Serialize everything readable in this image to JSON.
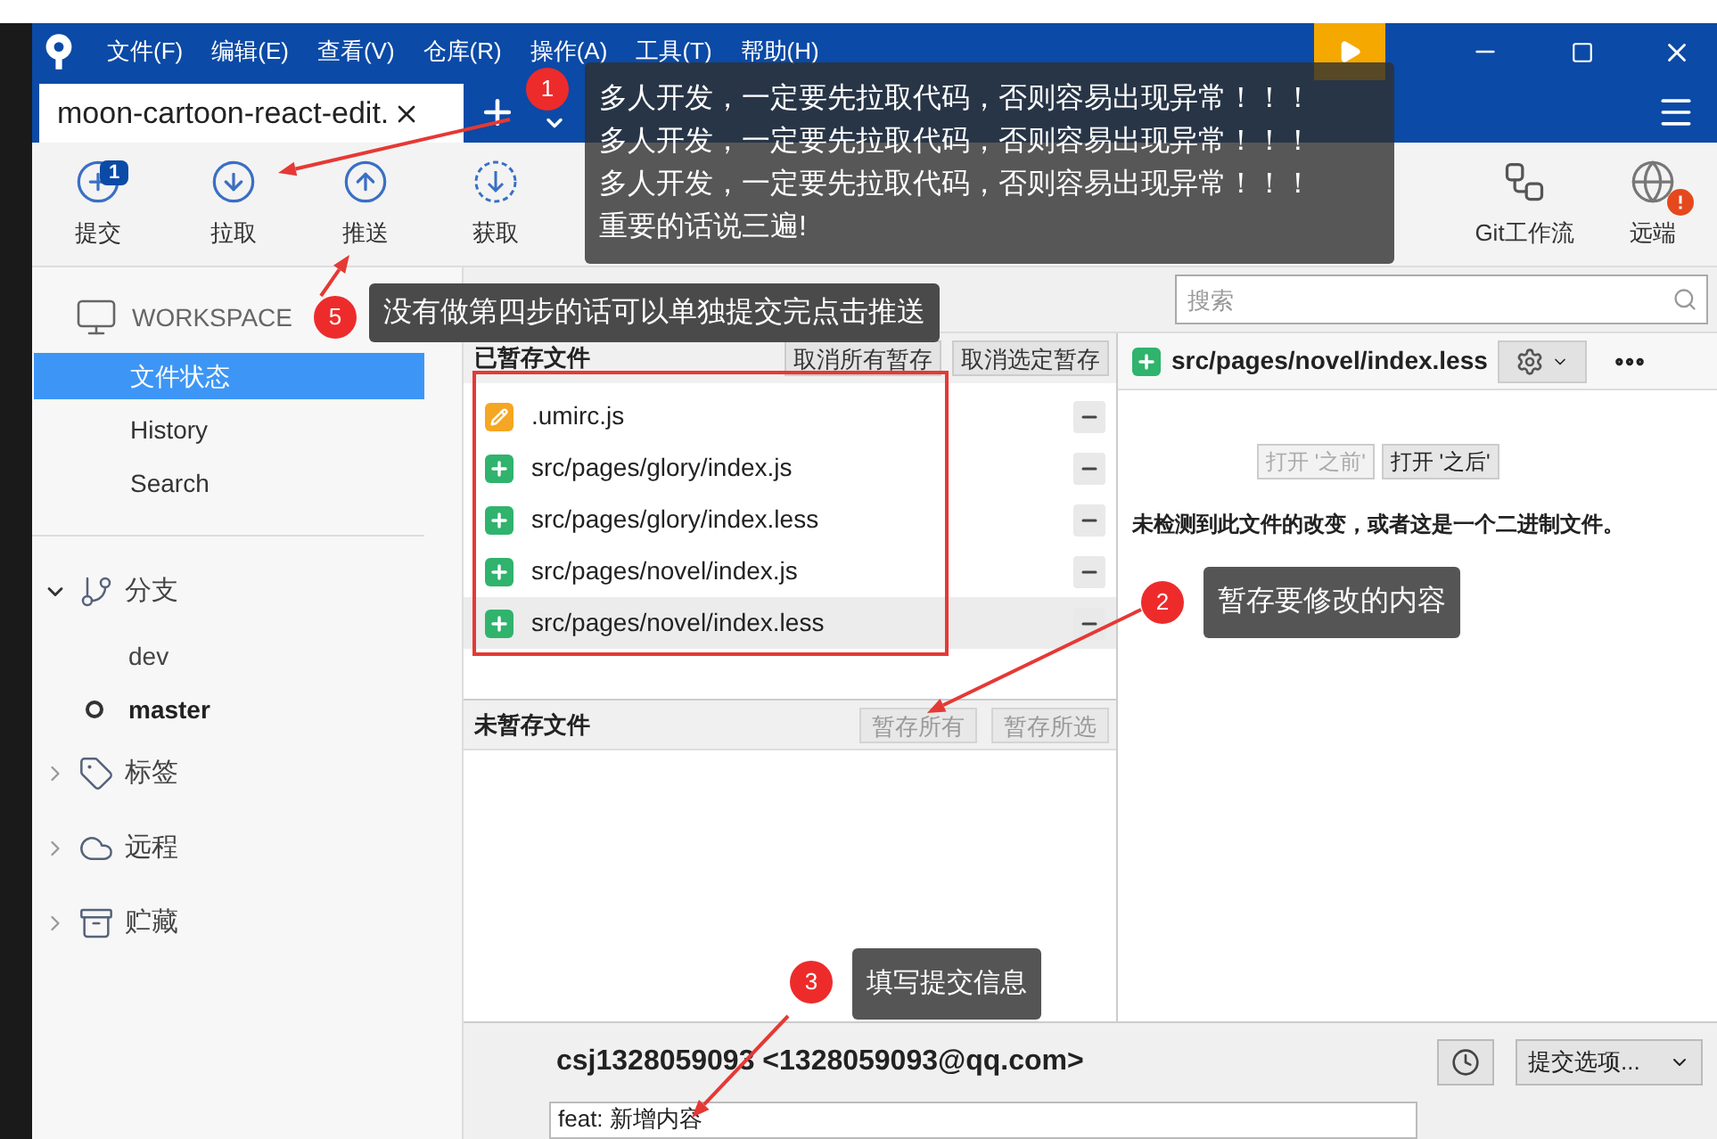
{
  "window": {
    "menu": [
      "文件(F)",
      "编辑(E)",
      "查看(V)",
      "仓库(R)",
      "操作(A)",
      "工具(T)",
      "帮助(H)"
    ],
    "tab": {
      "title": "moon-cartoon-react-edit.",
      "selected": true
    }
  },
  "toolbar": [
    {
      "kind": "commit",
      "label": "提交",
      "badge": "1"
    },
    {
      "kind": "pull",
      "label": "拉取"
    },
    {
      "kind": "push",
      "label": "推送"
    },
    {
      "kind": "fetch",
      "label": "获取"
    }
  ],
  "toolbar_right": [
    {
      "kind": "flow",
      "label": "Git工作流",
      "alert": false
    },
    {
      "kind": "remote",
      "label": "远端",
      "alert": true
    }
  ],
  "sidebar": {
    "workspace": "WORKSPACE",
    "items": [
      {
        "label": "文件状态",
        "selected": true
      },
      {
        "label": "History",
        "selected": false
      },
      {
        "label": "Search",
        "selected": false
      }
    ],
    "sections": [
      {
        "kind": "branch",
        "label": "分支",
        "expanded": true,
        "children": [
          {
            "label": "dev",
            "current": false
          },
          {
            "label": "master",
            "current": true
          }
        ]
      },
      {
        "kind": "tag",
        "label": "标签",
        "expanded": false
      },
      {
        "kind": "cloud",
        "label": "远程",
        "expanded": false
      },
      {
        "kind": "stash",
        "label": "贮藏",
        "expanded": false
      }
    ]
  },
  "search": {
    "placeholder": "搜索"
  },
  "staged": {
    "title": "已暂存文件",
    "buttons": [
      "取消所有暂存",
      "取消选定暂存"
    ],
    "files": [
      {
        "path": ".umirc.js",
        "kind": "modified",
        "selected": false
      },
      {
        "path": "src/pages/glory/index.js",
        "kind": "added",
        "selected": false
      },
      {
        "path": "src/pages/glory/index.less",
        "kind": "added",
        "selected": false
      },
      {
        "path": "src/pages/novel/index.js",
        "kind": "added",
        "selected": false
      },
      {
        "path": "src/pages/novel/index.less",
        "kind": "added",
        "selected": true
      }
    ]
  },
  "unstaged": {
    "title": "未暂存文件",
    "buttons": [
      {
        "label": "暂存所有",
        "disabled": true
      },
      {
        "label": "暂存所选",
        "disabled": true
      }
    ]
  },
  "diff": {
    "file": "src/pages/novel/index.less",
    "kind": "added",
    "buttons": [
      {
        "label": "打开 '之前'",
        "disabled": true
      },
      {
        "label": "打开 '之后'",
        "disabled": false
      }
    ],
    "message": "未检测到此文件的改变，或者这是一个二进制文件。"
  },
  "commit": {
    "author": "csj1328059093 <1328059093@qq.com>",
    "options": "提交选项...",
    "message": "feat: 新增内容"
  },
  "annotations": [
    {
      "number": "1",
      "lines": [
        "多人开发，一定要先拉取代码，否则容易出现异常！！！",
        "多人开发，一定要先拉取代码，否则容易出现异常！！！",
        "多人开发，一定要先拉取代码，否则容易出现异常！！！",
        "重要的话说三遍!"
      ]
    },
    {
      "number": "5",
      "lines": [
        "没有做第四步的话可以单独提交完点击推送"
      ]
    },
    {
      "number": "2",
      "lines": [
        "暂存要修改的内容"
      ]
    },
    {
      "number": "3",
      "lines": [
        "填写提交信息"
      ]
    }
  ]
}
